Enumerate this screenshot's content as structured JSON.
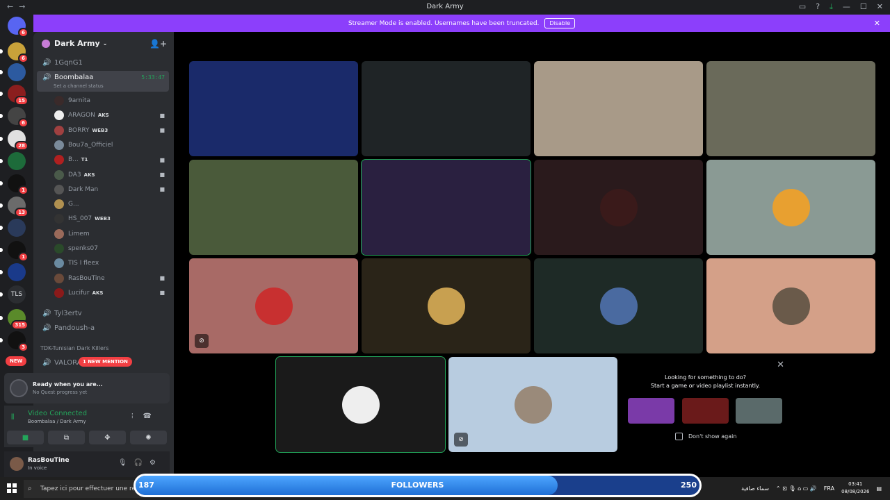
{
  "window": {
    "title": "Dark Army"
  },
  "banner": {
    "text": "Streamer Mode is enabled. Usernames have been truncated.",
    "button": "Disable"
  },
  "guilds": [
    {
      "badge": "6",
      "color": "#5865f2"
    },
    {
      "badge": "6",
      "color": "#c9a23a"
    },
    {
      "badge": "",
      "color": "#2c5aa0"
    },
    {
      "badge": "15",
      "color": "#8b1e1e"
    },
    {
      "badge": "6",
      "color": "#444"
    },
    {
      "badge": "28",
      "color": "#e0e0e0"
    },
    {
      "badge": "",
      "color": "#1d6b3a"
    },
    {
      "badge": "1",
      "color": "#111"
    },
    {
      "badge": "13",
      "color": "#6b6b6b"
    },
    {
      "badge": "",
      "color": "#2a3a5a"
    },
    {
      "badge": "1",
      "color": "#111"
    },
    {
      "badge": "",
      "color": "#1a3a8a"
    },
    {
      "badge": "",
      "color": "#2b2d31",
      "text": "TLS"
    },
    {
      "badge": "315",
      "color": "#5a8a2a"
    },
    {
      "badge": "3",
      "color": "#111"
    }
  ],
  "new_pill": "NEW",
  "server": {
    "name": "Dark Army"
  },
  "channels": {
    "top": "1GqnG1",
    "active": {
      "name": "Boombalaa",
      "timer": "5:33:47",
      "status": "Set a channel status"
    },
    "members": [
      {
        "name": "9arnita",
        "tag": "",
        "av": "#3a2a2a"
      },
      {
        "name": "ARAGON",
        "tag": "AKS",
        "av": "#eee"
      },
      {
        "name": "BORRY",
        "tag": "WEB3",
        "av": "#a04040"
      },
      {
        "name": "Bou7a_Officiel",
        "tag": "",
        "av": "#7a8a9a"
      },
      {
        "name": "B...",
        "tag": "T1",
        "av": "#b02020"
      },
      {
        "name": "DA3",
        "tag": "AKS",
        "av": "#4a5a4a"
      },
      {
        "name": "Dark Man",
        "tag": "",
        "av": "#555"
      },
      {
        "name": "G...",
        "tag": "",
        "av": "#b09050"
      },
      {
        "name": "HS_007",
        "tag": "WEB3",
        "av": "#333"
      },
      {
        "name": "Limem",
        "tag": "",
        "av": "#9a6a5a"
      },
      {
        "name": "spenks07",
        "tag": "",
        "av": "#2a4a2a"
      },
      {
        "name": "TIS I fleex",
        "tag": "",
        "av": "#6a8aa0"
      },
      {
        "name": "RasBouTine",
        "tag": "",
        "av": "#6a4a3a"
      },
      {
        "name": "Lucifur",
        "tag": "AKS",
        "av": "#8a1a1a"
      }
    ],
    "after": [
      "Tyl3ertv",
      "Pandoush-a"
    ],
    "category": "TDK-Tunisian Dark Killers",
    "valorant": "VALORA",
    "mention": "1 NEW MENTION"
  },
  "quest": {
    "title": "Ready when you are...",
    "sub": "No Quest progress yet"
  },
  "voice": {
    "status": "Video Connected",
    "location": "Boombalaa / Dark Army"
  },
  "user": {
    "name": "RasBouTine",
    "status": "In voice"
  },
  "tiles": [
    {
      "bg": "#1a2a6a",
      "avatar": ""
    },
    {
      "bg": "#1f2426",
      "avatar": ""
    },
    {
      "bg": "#a89a88",
      "avatar": ""
    },
    {
      "bg": "#6a6a5a",
      "avatar": ""
    },
    {
      "bg": "#4a5a3a",
      "avatar": ""
    },
    {
      "bg": "#2a2040",
      "avatar": ""
    },
    {
      "bg": "#2a1a1c",
      "avatar": "#3a1a1a"
    },
    {
      "bg": "#8a9a94",
      "avatar": "#e8a030"
    },
    {
      "bg": "#a86a66",
      "avatar": "#c83030"
    },
    {
      "bg": "#2a2418",
      "avatar": "#c8a050"
    },
    {
      "bg": "#1e2a26",
      "avatar": "#4a6aa0"
    },
    {
      "bg": "#d4a088",
      "avatar": "#6a5a4a"
    },
    {
      "bg": "#1a1a1a",
      "avatar": "#eeeeee"
    },
    {
      "bg": "#b8cce0",
      "avatar": "#9a8a7a"
    }
  ],
  "activity": {
    "line1": "Looking for something to do?",
    "line2": "Start a game or video playlist instantly.",
    "dont_show": "Don't show again",
    "games": [
      "#7a3aa8",
      "#6a1a1a",
      "#5a6a6a"
    ]
  },
  "taskbar": {
    "search_placeholder": "Tapez ici pour effectuer une re",
    "followers": {
      "current": "187",
      "label": "FOLLOWERS",
      "goal": "250",
      "progress": 0.748
    },
    "weather": "سماء صافية",
    "lang": "FRA",
    "time": "03:41",
    "date": "08/08/2026"
  }
}
